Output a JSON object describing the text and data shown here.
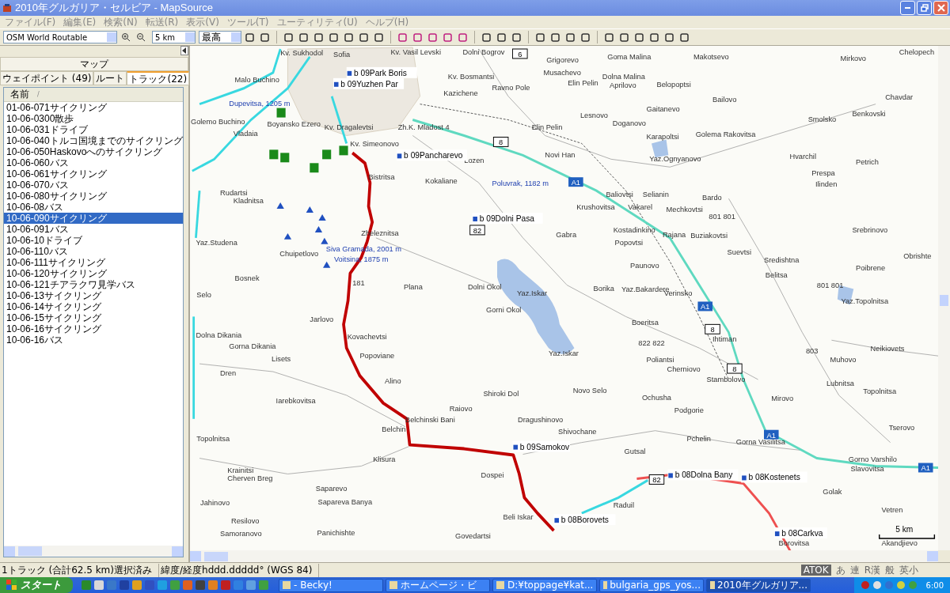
{
  "window": {
    "title": "2010年グルガリア・セルビア - MapSource"
  },
  "menu": [
    "ファイル(F)",
    "編集(E)",
    "検索(N)",
    "転送(R)",
    "表示(V)",
    "ツール(T)",
    "ユーティリティ(U)",
    "ヘルプ(H)"
  ],
  "toolbar": {
    "map_product": "OSM World Routable",
    "zoom": "5 km",
    "detail": "最高"
  },
  "sidebar": {
    "tabs": [
      {
        "label": "マップ",
        "selected": false
      },
      {
        "label": "ウェイポイント (49)",
        "selected": false
      },
      {
        "label": "ルート",
        "selected": false
      },
      {
        "label": "トラック(22)",
        "selected": true
      }
    ],
    "column": "名前",
    "sort_mark": "/",
    "tracks": [
      {
        "name": "01-06-071サイクリング",
        "selected": false
      },
      {
        "name": "10-06-0300散歩",
        "selected": false
      },
      {
        "name": "10-06-031ドライブ",
        "selected": false
      },
      {
        "name": "10-06-040トルコ国境までのサイクリング",
        "selected": false
      },
      {
        "name": "10-06-050Haskovoへのサイクリング",
        "selected": false
      },
      {
        "name": "10-06-060バス",
        "selected": false
      },
      {
        "name": "10-06-061サイクリング",
        "selected": false
      },
      {
        "name": "10-06-070バス",
        "selected": false
      },
      {
        "name": "10-06-080サイクリング",
        "selected": false
      },
      {
        "name": "10-06-08バス",
        "selected": false
      },
      {
        "name": "10-06-090サイクリング",
        "selected": true
      },
      {
        "name": "10-06-091バス",
        "selected": false
      },
      {
        "name": "10-06-10ドライブ",
        "selected": false
      },
      {
        "name": "10-06-110バス",
        "selected": false
      },
      {
        "name": "10-06-111サイクリング",
        "selected": false
      },
      {
        "name": "10-06-120サイクリング",
        "selected": false
      },
      {
        "name": "10-06-121チアラクワ見学バス",
        "selected": false
      },
      {
        "name": "10-06-13サイクリング",
        "selected": false
      },
      {
        "name": "10-06-14サイクリング",
        "selected": false
      },
      {
        "name": "10-06-15サイクリング",
        "selected": false
      },
      {
        "name": "10-06-16サイクリング",
        "selected": false
      },
      {
        "name": "10-06-16バス",
        "selected": false
      }
    ]
  },
  "map": {
    "places": [
      "Kv. Sukhodol",
      "Sofia",
      "Kv. Vasil Levski",
      "Dolni Bogrov",
      "Grigorevo",
      "Goma Malina",
      "Makotsevo",
      "Mirkovo",
      "Chelopech",
      "Malo Buchino",
      "Kv. Bosmantsi",
      "Musachevo",
      "Dolna Malina",
      "Aprilovo",
      "Belopoptsi",
      "Chavdar",
      "Ravno Pole",
      "Elin Pelin",
      "Kazichene",
      "Lesnovo",
      "Gaitanevo",
      "Bailovo",
      "Benkovski",
      "Dupevitsa, 1205 m",
      "Golemo Buchino",
      "Vladaia",
      "Boyansko Ezero",
      "Kv. Dragalevtsi",
      "Zh.K. Mladost 4",
      "Elin Pelin",
      "Doganovo",
      "Smolsko",
      "Karapoltsi",
      "Golema Rakovitsa",
      "Kv. Simeonovo",
      "Lozen",
      "Novi Han",
      "Yaz.Ognyanovo",
      "Hvarchil",
      "Petrich",
      "Kokaliane",
      "Prespa",
      "Ilinden",
      "Rudartsi",
      "Bistritsa",
      "Poluvrak, 1182 m",
      "Baliovtsi",
      "Selianin",
      "Bardo",
      "Krushovitsa",
      "Vakarel",
      "Mechkovtsi",
      "801 801",
      "Kladnitsa",
      "Gabra",
      "Kostadinkino",
      "Rajana",
      "Buziakovtsi",
      "Srebrinovo",
      "Popovtsi",
      "Zheleznitsa",
      "Yaz.Studena",
      "Chuipetlovo",
      "Siva Gramada, 2001 m",
      "Voitsina, 1875 m",
      "Suevtsi",
      "Obrishte",
      "Paunovo",
      "Sredishtna",
      "Belitsa",
      "Poibrene",
      "Bosnek",
      "Plana",
      "Dolni Okol",
      "Borika",
      "Yaz.Bakardere",
      "Verinsko",
      "801 801",
      "Yaz.Topolnitsa",
      "Gorni Okol",
      "Jarlovo",
      "Kovachevtsi",
      "Boeritsa",
      "Dolna Dikania",
      "Gorna Dikania",
      "Lisets",
      "Popoviane",
      "Yaz.Iskar",
      "Yaz.Iskar",
      "Poliantsi",
      "Cherniovo",
      "822 822",
      "Ihtiman",
      "803",
      "Neikiovets",
      "Muhovo",
      "Dren",
      "Alino",
      "Stambolovo",
      "Lubnitsa",
      "Topolnitsa",
      "Iarebkovitsa",
      "Shiroki Dol",
      "Novo Selo",
      "Ochusha",
      "Mirovo",
      "Belchinski Bani",
      "Raiovo",
      "Podgorie",
      "Dragushinovo",
      "Belchin",
      "Topolnitsa",
      "Shivochane",
      "Tserovo",
      "Pchelin",
      "Gorna Vasilitsa",
      "Gutsal",
      "Klisura",
      "Krainitsi",
      "Cherven Breg",
      "Dospei",
      "Gorno Varshilo",
      "Slavovitsa",
      "Saparevo",
      "Sapareva Banya",
      "Raduil",
      "Golak",
      "Jahinovo",
      "Beli Iskar",
      "Vetren",
      "Resilovo",
      "Samoranovo",
      "Panichishte",
      "Govedartsi",
      "Borovitsa",
      "Akandjievo",
      "Selo",
      "181"
    ],
    "waypoints": [
      "b 09Park Boris",
      "b 09Yuzhen Par",
      "b 09Pancharevo",
      "b 09Dolni Pasa",
      "b 09Samokov",
      "b 08Dolna Bany",
      "b 08Kostenets",
      "b 08Borovets",
      "b 08Carkva"
    ],
    "road_shields": [
      {
        "label": "6",
        "kind": "national"
      },
      {
        "label": "8",
        "kind": "national"
      },
      {
        "label": "8",
        "kind": "national"
      },
      {
        "label": "8",
        "kind": "national"
      },
      {
        "label": "82",
        "kind": "national"
      },
      {
        "label": "82",
        "kind": "national"
      },
      {
        "label": "A1",
        "kind": "motorway"
      },
      {
        "label": "A1",
        "kind": "motorway"
      },
      {
        "label": "A1",
        "kind": "motorway"
      },
      {
        "label": "A1",
        "kind": "motorway"
      }
    ],
    "scale": "5 km"
  },
  "status_bar": {
    "selection": "1トラック (合計62.5 km)選択済み",
    "format": "緯度/経度hddd.ddddd° (WGS 84)"
  },
  "ime_bar": [
    "ATOK",
    "あ",
    "連",
    "R漢",
    "般",
    "英小"
  ],
  "taskbar": {
    "start": "スタート",
    "tasks": [
      {
        "label": "- Becky!",
        "selected": false
      },
      {
        "label": "ホームページ・ビ",
        "selected": false
      },
      {
        "label": "D:¥toppage¥kat...",
        "selected": false
      },
      {
        "label": "bulgaria_gps_yos...",
        "selected": false
      },
      {
        "label": "2010年グルガリア...",
        "selected": true
      }
    ],
    "clock": "6:00"
  }
}
